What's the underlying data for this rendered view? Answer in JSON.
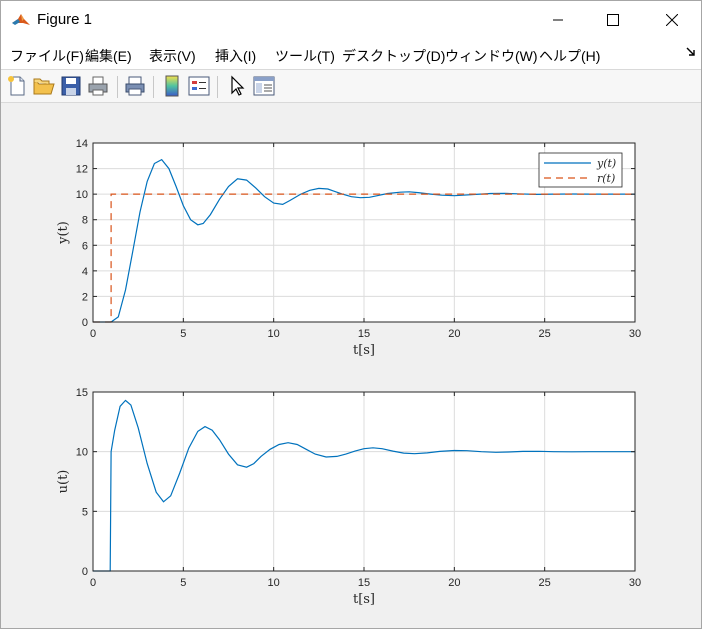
{
  "window": {
    "title": "Figure 1"
  },
  "menu": [
    {
      "label": "ファイル(F)"
    },
    {
      "label": "編集(E)"
    },
    {
      "label": "表示(V)"
    },
    {
      "label": "挿入(I)"
    },
    {
      "label": "ツール(T)"
    },
    {
      "label": "デスクトップ(D)"
    },
    {
      "label": "ウィンドウ(W)"
    },
    {
      "label": "ヘルプ(H)"
    }
  ],
  "toolbar": {
    "icons": [
      "new-figure-icon",
      "open-file-icon",
      "save-icon",
      "print-icon",
      "print-preview-icon",
      "colorbar-icon",
      "legend-icon",
      "pointer-icon",
      "property-editor-icon"
    ]
  },
  "colors": {
    "y_line": "#0072bd",
    "r_line": "#d95319",
    "axes_bg": "#ffffff",
    "grid": "#dcdcdc"
  },
  "chart_data": [
    {
      "type": "line",
      "xlabel": "t[s]",
      "ylabel": "y(t)",
      "xlim": [
        0,
        30
      ],
      "ylim": [
        0,
        14
      ],
      "xticks": [
        0,
        5,
        10,
        15,
        20,
        25,
        30
      ],
      "yticks": [
        0,
        2,
        4,
        6,
        8,
        10,
        12,
        14
      ],
      "grid": true,
      "legend_position": "top-right",
      "series": [
        {
          "name": "y(t)",
          "style": "solid",
          "x": [
            0,
            1.0,
            1.4,
            1.8,
            2.2,
            2.6,
            3.0,
            3.4,
            3.8,
            4.2,
            4.6,
            5.0,
            5.4,
            5.8,
            6.1,
            6.5,
            7.0,
            7.5,
            8.0,
            8.5,
            9.0,
            9.5,
            10.0,
            10.5,
            10.9,
            11.5,
            12.0,
            12.5,
            13.0,
            13.3,
            13.8,
            14.3,
            14.8,
            15.3,
            15.8,
            16.3,
            17.0,
            17.5,
            18.0,
            18.7,
            19.3,
            20.0,
            20.5,
            21.2,
            22.0,
            22.8,
            23.5,
            24.5,
            25.5,
            26.5,
            27.5,
            28.5,
            30.0
          ],
          "y": [
            0,
            0,
            0.4,
            2.5,
            5.5,
            8.6,
            11.0,
            12.4,
            12.7,
            12.0,
            10.6,
            9.1,
            8.0,
            7.6,
            7.7,
            8.4,
            9.6,
            10.6,
            11.2,
            11.1,
            10.5,
            9.8,
            9.3,
            9.2,
            9.5,
            10.0,
            10.3,
            10.45,
            10.4,
            10.25,
            10.0,
            9.8,
            9.72,
            9.75,
            9.9,
            10.05,
            10.15,
            10.18,
            10.12,
            10.0,
            9.92,
            9.88,
            9.92,
            9.98,
            10.05,
            10.06,
            10.03,
            9.98,
            10.0,
            10.01,
            10.0,
            10.0,
            10.0
          ]
        },
        {
          "name": "r(t)",
          "style": "dashed",
          "x": [
            0,
            1.0,
            1.0,
            30.0
          ],
          "y": [
            0,
            0,
            10,
            10
          ]
        }
      ]
    },
    {
      "type": "line",
      "xlabel": "t[s]",
      "ylabel": "u(t)",
      "xlim": [
        0,
        30
      ],
      "ylim": [
        0,
        15
      ],
      "xticks": [
        0,
        5,
        10,
        15,
        20,
        25,
        30
      ],
      "yticks": [
        0,
        5,
        10,
        15
      ],
      "grid": true,
      "series": [
        {
          "name": "u(t)",
          "style": "solid",
          "x": [
            0,
            0.95,
            1.0,
            1.2,
            1.5,
            1.8,
            2.1,
            2.5,
            3.0,
            3.5,
            3.9,
            4.3,
            4.8,
            5.3,
            5.8,
            6.2,
            6.6,
            7.0,
            7.5,
            8.0,
            8.5,
            8.9,
            9.3,
            9.8,
            10.3,
            10.8,
            11.3,
            11.8,
            12.3,
            12.9,
            13.5,
            14.0,
            14.5,
            15.0,
            15.5,
            16.0,
            16.6,
            17.2,
            17.8,
            18.5,
            19.2,
            20.0,
            20.7,
            21.5,
            22.3,
            23.0,
            23.8,
            24.7,
            25.5,
            26.5,
            27.5,
            28.5,
            30.0
          ],
          "y": [
            0,
            0,
            10.0,
            11.8,
            13.8,
            14.3,
            13.9,
            12.0,
            9.0,
            6.6,
            5.8,
            6.3,
            8.2,
            10.3,
            11.7,
            12.1,
            11.8,
            11.0,
            9.8,
            8.9,
            8.7,
            9.0,
            9.6,
            10.2,
            10.6,
            10.75,
            10.6,
            10.2,
            9.8,
            9.55,
            9.6,
            9.8,
            10.05,
            10.25,
            10.32,
            10.25,
            10.05,
            9.88,
            9.83,
            9.9,
            10.02,
            10.1,
            10.08,
            10.0,
            9.95,
            9.97,
            10.02,
            10.03,
            10.0,
            9.99,
            10.0,
            10.0,
            10.0
          ]
        }
      ]
    }
  ]
}
